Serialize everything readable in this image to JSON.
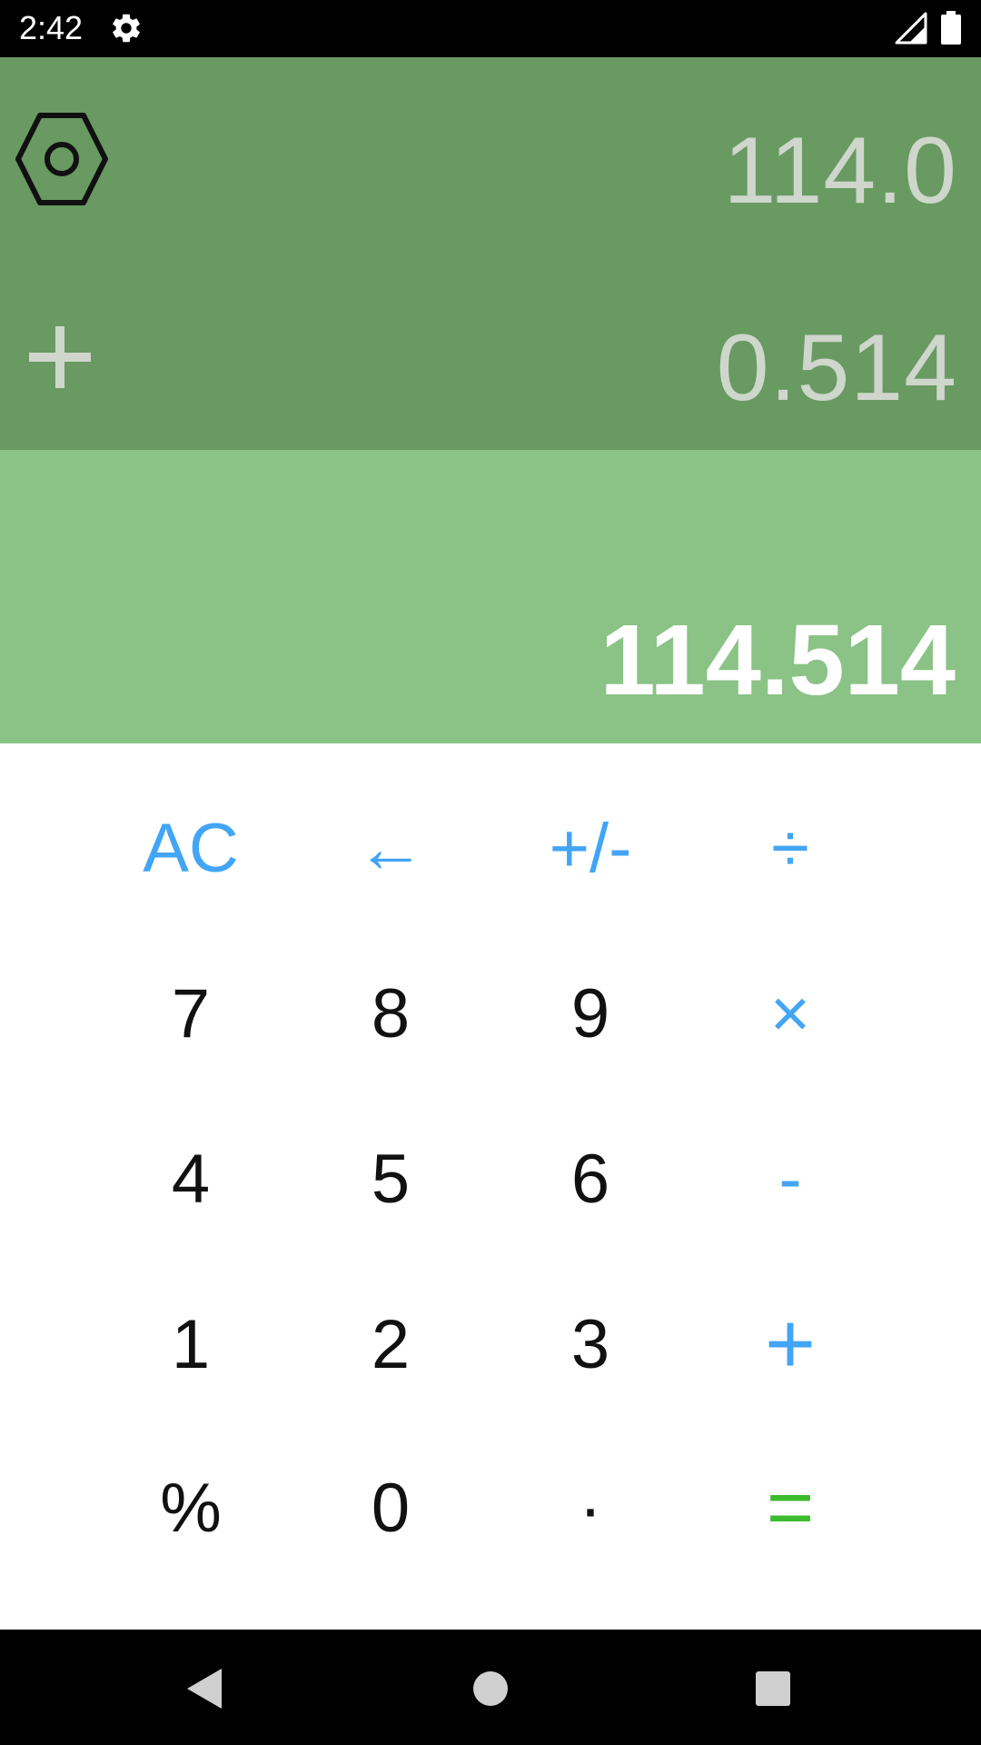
{
  "status_bar": {
    "time": "2:42",
    "icons": [
      "gear-icon",
      "signal-icon",
      "battery-icon"
    ]
  },
  "history": {
    "first_value": "114.0",
    "operator": "+",
    "second_value": "0.514",
    "settings_icon": "hexagon-nut-icon"
  },
  "result": {
    "value": "114.514"
  },
  "keypad": {
    "row1": {
      "ac": "AC",
      "backspace": "←",
      "sign": "+/-",
      "divide": "÷"
    },
    "row2": {
      "seven": "7",
      "eight": "8",
      "nine": "9",
      "multiply": "×"
    },
    "row3": {
      "four": "4",
      "five": "5",
      "six": "6",
      "minus": "-"
    },
    "row4": {
      "one": "1",
      "two": "2",
      "three": "3",
      "plus": "+"
    },
    "row5": {
      "percent": "%",
      "zero": "0",
      "dot": "·",
      "equals": "="
    }
  },
  "nav_bar": {
    "icons": [
      "back-icon",
      "home-icon",
      "recents-icon"
    ]
  },
  "colors": {
    "status_bar": "#000000",
    "history_bg": "#689a62",
    "result_bg": "#8bc286",
    "history_text": "#cfd6cc",
    "result_text": "#ffffff",
    "operator_key": "#42a5f5",
    "equals_key": "#3dbb2e",
    "digit_key": "#111111",
    "nav_bar": "#000000"
  }
}
